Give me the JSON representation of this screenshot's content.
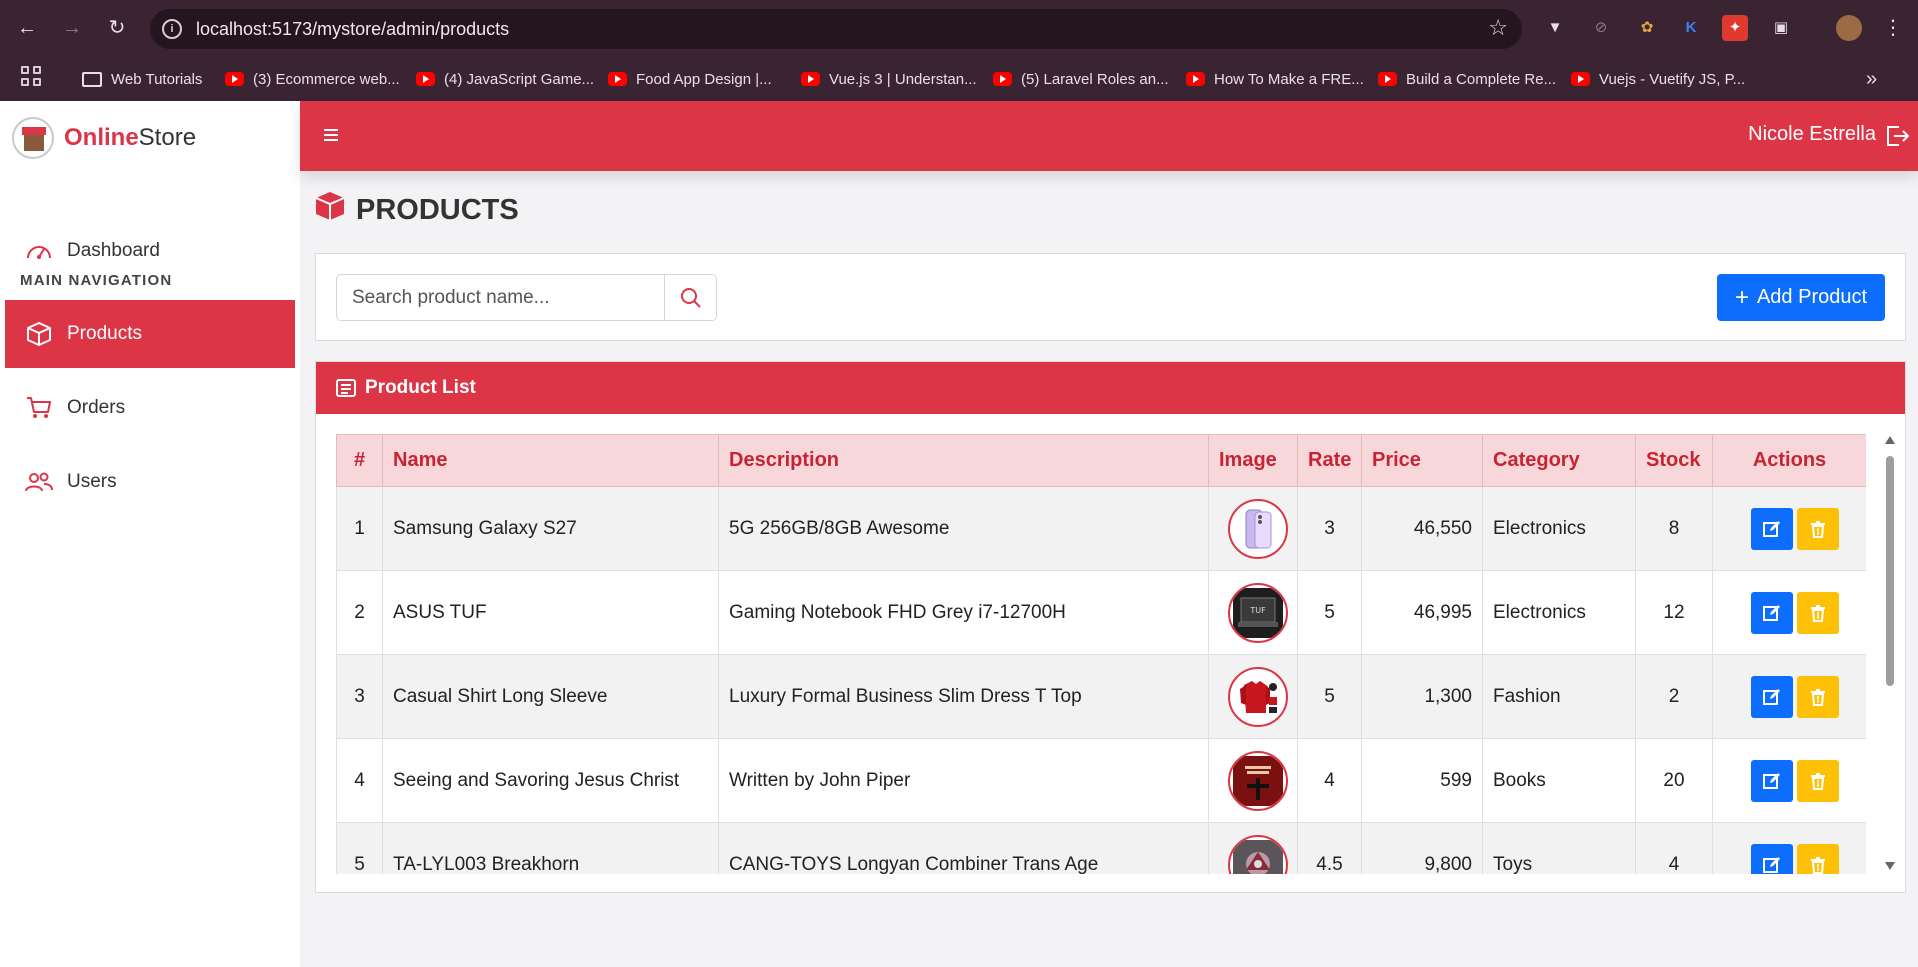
{
  "browser": {
    "url": "localhost:5173/mystore/admin/products",
    "bookmarks": [
      {
        "label": "Web Tutorials",
        "icon": "folder-icon"
      },
      {
        "label": "(3) Ecommerce web...",
        "icon": "youtube-icon"
      },
      {
        "label": "(4) JavaScript Game...",
        "icon": "youtube-icon"
      },
      {
        "label": "Food App Design |...",
        "icon": "youtube-icon"
      },
      {
        "label": "Vue.js 3 | Understan...",
        "icon": "youtube-icon"
      },
      {
        "label": "(5) Laravel Roles an...",
        "icon": "youtube-icon"
      },
      {
        "label": "How To Make a FRE...",
        "icon": "youtube-icon"
      },
      {
        "label": "Build a Complete Re...",
        "icon": "youtube-icon"
      },
      {
        "label": "Vuejs - Vuetify JS, P...",
        "icon": "youtube-icon"
      }
    ],
    "more_bookmarks": "»"
  },
  "brand": {
    "bold": "Online",
    "rest": "Store"
  },
  "sidebar": {
    "dashboard": "Dashboard",
    "section_heading": "MAIN NAVIGATION",
    "items": [
      {
        "label": "Products",
        "icon": "box-icon",
        "active": true
      },
      {
        "label": "Orders",
        "icon": "cart-icon",
        "active": false
      },
      {
        "label": "Users",
        "icon": "users-icon",
        "active": false
      }
    ]
  },
  "topbar": {
    "user": "Nicole Estrella"
  },
  "page": {
    "title": "PRODUCTS"
  },
  "toolbar": {
    "search_placeholder": "Search product name...",
    "add_label": "Add Product"
  },
  "list": {
    "title": "Product List",
    "columns": [
      "#",
      "Name",
      "Description",
      "Image",
      "Rate",
      "Price",
      "Category",
      "Stock",
      "Actions"
    ],
    "rows": [
      {
        "no": "1",
        "name": "Samsung Galaxy S27",
        "description": "5G 256GB/8GB Awesome",
        "image": "phone",
        "rate": "3",
        "price": "46,550",
        "category": "Electronics",
        "stock": "8"
      },
      {
        "no": "2",
        "name": "ASUS TUF",
        "description": "Gaming Notebook FHD Grey i7-12700H",
        "image": "laptop",
        "rate": "5",
        "price": "46,995",
        "category": "Electronics",
        "stock": "12"
      },
      {
        "no": "3",
        "name": "Casual Shirt Long Sleeve",
        "description": "Luxury Formal Business Slim Dress T Top",
        "image": "shirt",
        "rate": "5",
        "price": "1,300",
        "category": "Fashion",
        "stock": "2"
      },
      {
        "no": "4",
        "name": "Seeing and Savoring Jesus Christ",
        "description": "Written by John Piper",
        "image": "book",
        "rate": "4",
        "price": "599",
        "category": "Books",
        "stock": "20"
      },
      {
        "no": "5",
        "name": "TA-LYL003 Breakhorn",
        "description": "CANG-TOYS Longyan Combiner Trans Age",
        "image": "toy",
        "rate": "4.5",
        "price": "9,800",
        "category": "Toys",
        "stock": "4"
      }
    ]
  },
  "colors": {
    "primary": "#dc3545",
    "blue": "#0d6efd",
    "yellow": "#ffc107",
    "header_tint": "#f8d7da"
  }
}
